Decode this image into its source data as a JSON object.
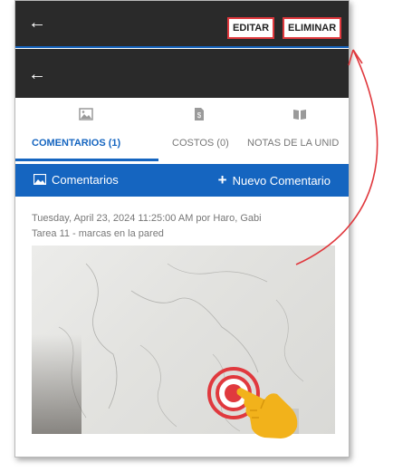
{
  "topbar": {
    "back_icon": "arrow-left-icon",
    "edit_label": "EDITAR",
    "delete_label": "ELIMINAR"
  },
  "secondbar": {
    "back_icon": "arrow-left-icon"
  },
  "tabs": [
    {
      "label": "COMENTARIOS (1)",
      "icon": "image-icon",
      "active": true
    },
    {
      "label": "COSTOS (0)",
      "icon": "cost-document-icon",
      "active": false
    },
    {
      "label": "NOTAS DE LA UNID",
      "icon": "book-icon",
      "active": false
    }
  ],
  "comments_bar": {
    "title": "Comentarios",
    "title_icon": "image-icon",
    "new_label": "Nuevo Comentario",
    "new_icon": "plus-icon"
  },
  "comment": {
    "meta": "Tuesday, April 23, 2024 11:25:00 AM por Haro, Gabi",
    "text": "Tarea 11 - marcas en la pared"
  },
  "colors": {
    "accent": "#1565c0",
    "bar": "#2a2a2a",
    "highlight": "#e0393e",
    "hand": "#f2b21b"
  }
}
